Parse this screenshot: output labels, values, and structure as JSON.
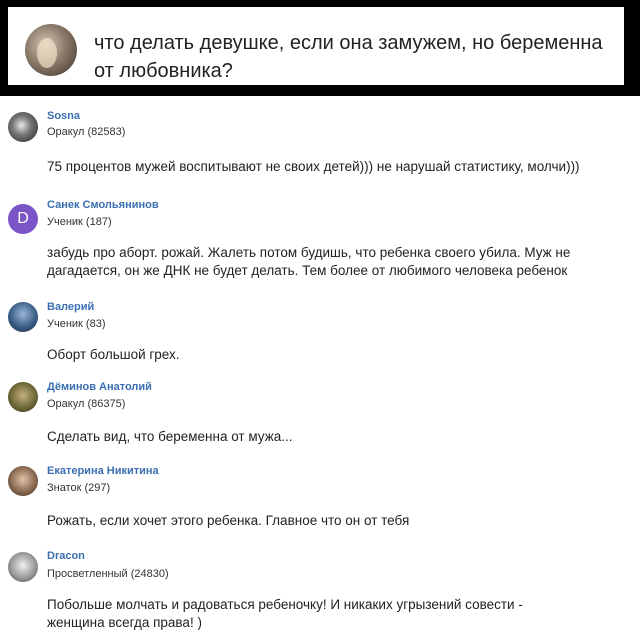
{
  "question": {
    "text": "что делать девушке, если она замужем, но беременна от любовника?"
  },
  "answers": [
    {
      "author": "Sosna",
      "rank": "Оракул (82583)",
      "avatar_icon": "user-photo-icon",
      "text": "75 процентов мужей воспитывают не своих детей))) не нарушай статистику, молчи)))"
    },
    {
      "author": "Санек Смольянинов",
      "rank": "Ученик (187)",
      "avatar_letter": "D",
      "avatar_color": "#7b55c7",
      "text": "забудь про аборт. рожай. Жалеть потом будишь, что ребенка своего убила. Муж не дагадается, он же ДНК не будет делать. Тем более от любимого человека ребенок"
    },
    {
      "author": "Валерий",
      "rank": "Ученик (83)",
      "avatar_icon": "user-photo-icon",
      "text": "Оборт большой грех."
    },
    {
      "author": "Дёминов Анатолий",
      "rank": "Оракул (86375)",
      "avatar_icon": "user-photo-icon",
      "text": "Сделать вид, что беременна от мужа..."
    },
    {
      "author": "Екатерина Никитина",
      "rank": "Знаток (297)",
      "avatar_icon": "user-photo-icon",
      "text": "Рожать, если хочет этого ребенка. Главное что он от тебя"
    },
    {
      "author": "Dracon",
      "rank": "Просветленный (24830)",
      "avatar_icon": "user-photo-icon",
      "text": "Побольше молчать и радоваться ребеночку! И никаких угрызений совести - женщина всегда права! )"
    }
  ],
  "colors": {
    "author_link": "#3a6fb2",
    "frame": "#000000"
  }
}
